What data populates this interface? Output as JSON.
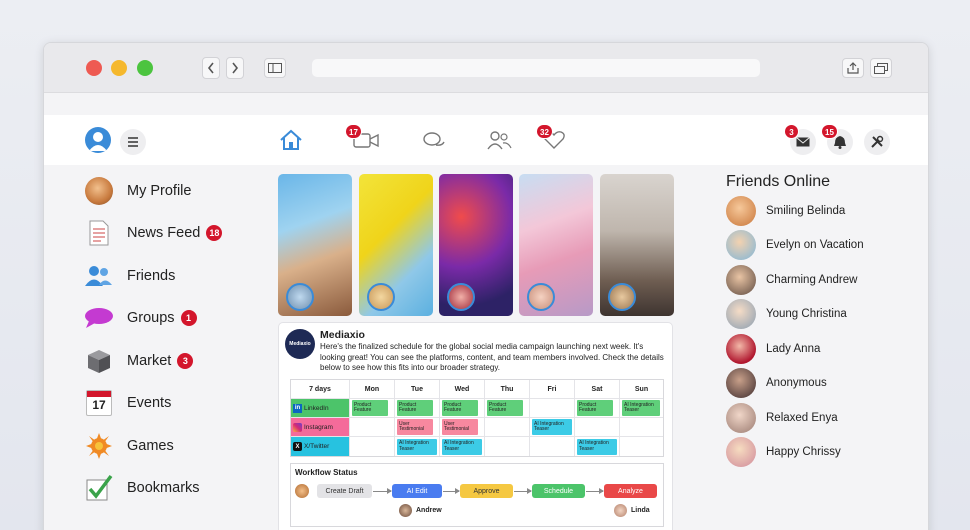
{
  "nav": {
    "video_badge": "17",
    "heart_badge": "32",
    "mail_badge": "3",
    "bell_badge": "15"
  },
  "sidebar": {
    "items": [
      {
        "label": "My Profile",
        "badge": ""
      },
      {
        "label": "News Feed",
        "badge": "18"
      },
      {
        "label": "Friends",
        "badge": ""
      },
      {
        "label": "Groups",
        "badge": "1"
      },
      {
        "label": "Market",
        "badge": "3"
      },
      {
        "label": "Events",
        "badge": ""
      },
      {
        "label": "Games",
        "badge": ""
      },
      {
        "label": "Bookmarks",
        "badge": ""
      }
    ],
    "calendar_day": "17"
  },
  "post": {
    "author": "Mediaxio",
    "logo_text": "Mediaxio",
    "text": "Here's the finalized schedule for the global social media campaign launching next week. It's looking great! You can see the platforms, content, and team members involved. Check the details below to see how this fits into our broader strategy.",
    "calendar": {
      "headers": [
        "7 days",
        "Mon",
        "Tue",
        "Wed",
        "Thu",
        "Fri",
        "Sat",
        "Sun"
      ],
      "rows": [
        {
          "platform": "LinkedIn",
          "cells": [
            "Product Feature",
            "Product Feature",
            "Product Feature",
            "Product Feature",
            "",
            "Product Feature",
            "AI Integration Teaser"
          ]
        },
        {
          "platform": "Instagram",
          "cells": [
            "",
            "User Testimonial",
            "User Testimonial",
            "",
            "AI Integration Teaser",
            "",
            ""
          ]
        },
        {
          "platform": "X/Twitter",
          "cells": [
            "",
            "AI Integration Teaser",
            "AI Integration Teaser",
            "",
            "",
            "AI Integration Teaser",
            ""
          ]
        }
      ]
    },
    "workflow": {
      "title": "Workflow Status",
      "steps": [
        "Create Draft",
        "AI Edit",
        "Approve",
        "Schedule",
        "Analyze"
      ],
      "assignees": [
        "Andrew",
        "Linda"
      ]
    }
  },
  "friends": {
    "title": "Friends Online",
    "list": [
      "Smiling Belinda",
      "Evelyn on Vacation",
      "Charming Andrew",
      "Young Christina",
      "Lady Anna",
      "Anonymous",
      "Relaxed Enya",
      "Happy Chrissy"
    ]
  },
  "colors": {
    "accent": "#3a8bd8",
    "badge": "#d3162c",
    "linkedin": "#4cc46a",
    "instagram": "#f46b9a",
    "twitter": "#27c2e0"
  }
}
